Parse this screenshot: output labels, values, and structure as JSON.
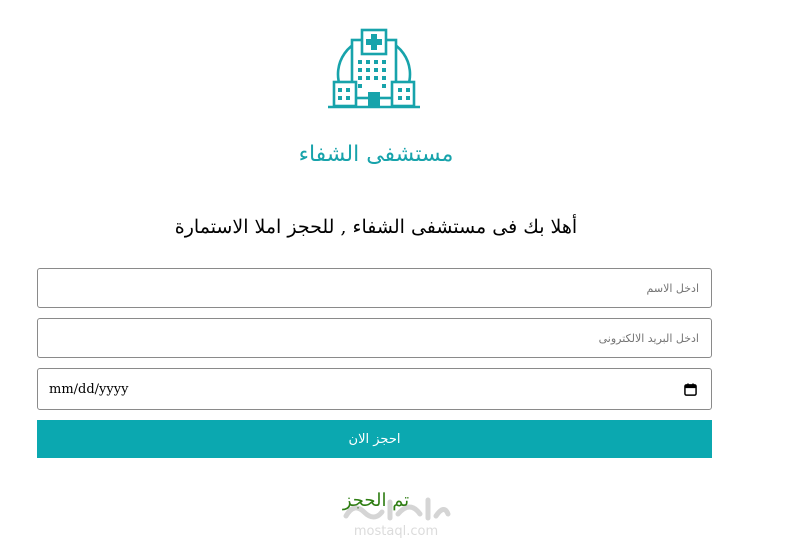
{
  "header": {
    "logo_icon": "hospital-building-icon",
    "hospital_name": "مستشفى الشفاء",
    "welcome_text": "أهلا بك فى مستشفى الشفاء , للحجز املا الاستمارة"
  },
  "form": {
    "name_placeholder": "ادخل الاسم",
    "email_placeholder": "ادخل البريد الالكترونى",
    "date_value": "mm/dd/yyyy",
    "date_icon": "calendar-icon",
    "submit_label": "احجز الان"
  },
  "confirmation_text": "تم الحجز",
  "watermark": {
    "site": "mostaql.com"
  },
  "colors": {
    "accent": "#0ba8b0",
    "title": "#17a3ab",
    "confirmation": "#2e7d12"
  }
}
